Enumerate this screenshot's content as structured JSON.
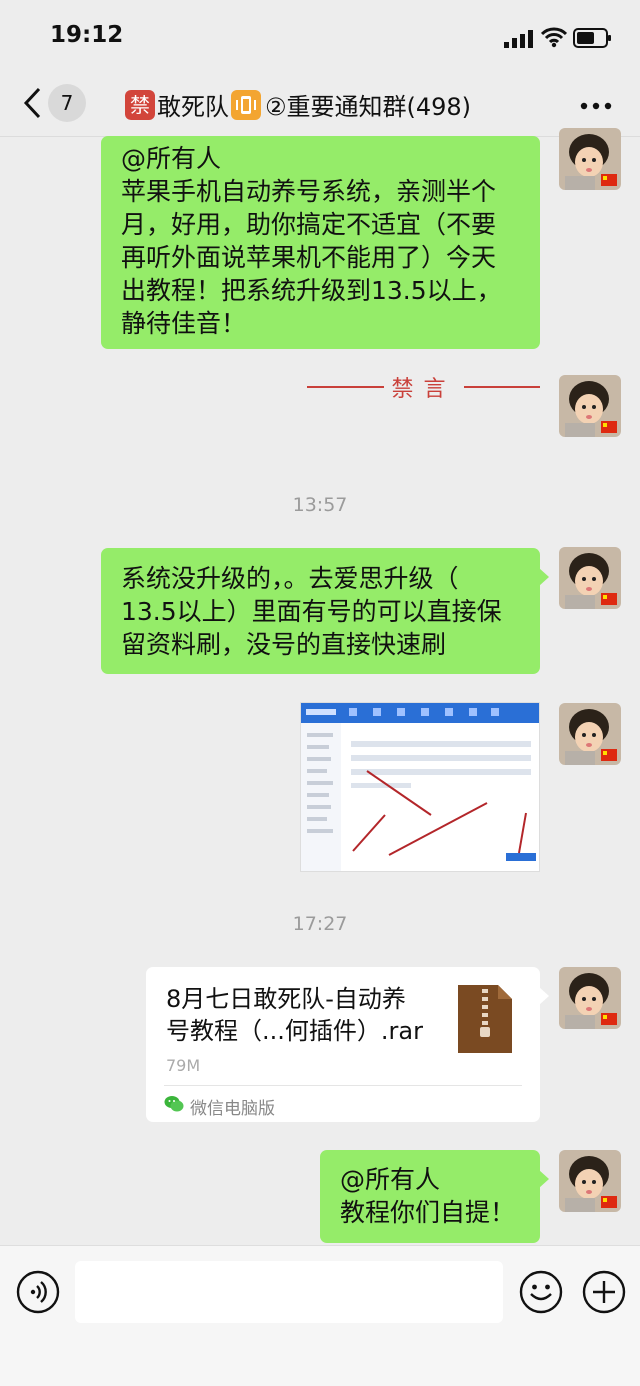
{
  "status_bar": {
    "time": "19:12"
  },
  "nav": {
    "back_count": "7",
    "ban_chip": "禁",
    "title": "敢死队",
    "title_rest": "②重要通知群(498)"
  },
  "messages": {
    "m1": {
      "lines": [
        "@所有人",
        "苹果手机自动养号系统，亲测半个",
        "月，好用，助你搞定不适宜（不要",
        "再听外面说苹果机不能用了）今天",
        "出教程！把系统升级到13.5以上，",
        "静待佳音！"
      ]
    },
    "ban_text": "禁言",
    "ts1": "13:57",
    "m2": {
      "lines": [
        "系统没升级的，。去爱思升级（",
        "13.5以上）里面有号的可以直接保",
        "留资料刷，没号的直接快速刷"
      ]
    },
    "ts2": "17:27",
    "file": {
      "name_line1": "8月七日敢死队-自动养",
      "name_line2": "号教程（...何插件）.rar",
      "size": "79M",
      "source": "微信电脑版"
    },
    "m3": {
      "lines": [
        "@所有人",
        "教程你们自提！"
      ]
    }
  },
  "colors": {
    "bubble": "#95ec69",
    "ban_red": "#c9403a",
    "background": "#ededed"
  },
  "icons": [
    "signal-icon",
    "wifi-icon",
    "battery-icon",
    "back-chevron-icon",
    "more-icon",
    "voice-icon",
    "emoji-icon",
    "plus-icon",
    "zip-file-icon",
    "wechat-pc-icon"
  ]
}
